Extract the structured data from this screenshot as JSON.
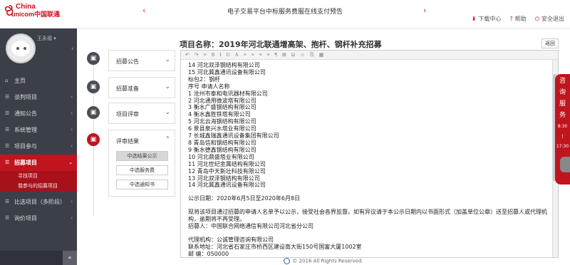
{
  "header": {
    "brand_top": "China",
    "brand_bottom": "unicom中国联通",
    "marquee_prev": "‹",
    "marquee_next": "›",
    "marquee_text": "电子交易平台中标服务费服在线支付预告",
    "links": [
      {
        "icon": "download-icon",
        "glyph": "⬇",
        "label": "下载中心"
      },
      {
        "icon": "help-icon",
        "glyph": "?",
        "label": "帮助"
      },
      {
        "icon": "logout-icon",
        "glyph": "⏻",
        "label": "安全退出"
      }
    ]
  },
  "sidebar": {
    "user_name": "王永福 ▾",
    "collapse": "‹",
    "items": [
      {
        "glyph": "⌂",
        "label": "主页",
        "arrow": "",
        "active": false
      },
      {
        "glyph": "☰",
        "label": "谈判项目",
        "arrow": "›",
        "active": false
      },
      {
        "glyph": "☰",
        "label": "通知公告",
        "arrow": "›",
        "active": false
      },
      {
        "glyph": "☰",
        "label": "系统管理",
        "arrow": "›",
        "active": false
      },
      {
        "glyph": "☰",
        "label": "项目参与",
        "arrow": "›",
        "active": false
      },
      {
        "glyph": "☰",
        "label": "招募项目",
        "arrow": "⌄",
        "active": true
      }
    ],
    "sub_items": [
      "寻找项目",
      "我参与的招募项目"
    ],
    "items_after": [
      {
        "glyph": "☰",
        "label": "比选项目（多阶段）",
        "arrow": "›"
      },
      {
        "glyph": "☰",
        "label": "询价项目",
        "arrow": "›"
      }
    ],
    "bottom_toggle": "«"
  },
  "steps": [
    {
      "label": "招募公告",
      "chevron": "⌄"
    },
    {
      "label": "招募准备",
      "chevron": "⌄"
    },
    {
      "label": "项目评审",
      "chevron": "⌄"
    },
    {
      "label": "评审结果",
      "chevron": "⌃",
      "buttons": [
        "中选结果公示",
        "中选服务费",
        "中选通知书"
      ]
    }
  ],
  "main": {
    "title": "项目名称：2019年河北联通增高架、抱杆、钢杆补充招募",
    "back": "返回",
    "toolbar": [
      "↶",
      "↷",
      "≡",
      "B",
      "I",
      "U",
      "A",
      "≡",
      "≡",
      "≡",
      "≡",
      "¶",
      "⊞",
      "Ω",
      "☺",
      "⎘",
      "▦"
    ],
    "lines_top": [
      "14 河北双泽钢结构有限公司",
      "15 河北冀鑫通讯设备有限公司",
      "标包2：钢杆",
      "序号  申请人名称",
      "1 沧州市泰和电讯器材有限公司",
      "2 河北通用微波塔有限公司",
      "3 衡水广盛钢结构有限公司",
      "4 衡水鑫胜铁塔有限公司",
      "5 河北云海钢结构有限公司",
      "6 景县泉兴水塔业有限公司",
      "7 长城鑫瑞鑫通讯设备集团有限公司",
      "8 青岛信和钢结构有限公司",
      "9 衡水德鑫钢结构有限公司",
      "10 河北鼎盛塔业有限公司",
      "11 河北世纪金属结构有限公司",
      "12 青岛中天斯壮科技有限公司",
      "13 河北双泽钢结构有限公司",
      "14 河北冀鑫通讯设备有限公司"
    ],
    "period": "公示日期：2020年6月5日至2020年6月8日",
    "notice": "现将该项目通过招募的申请人名单予以公示，接受社会各界监督。如有异议请于本公示日期内以书面形式（加盖单位公章）送至招募人或代理机构，逾期将不再受理。",
    "recruiter": "招募人：中国联合网络通信有限公司河北省分公司",
    "agency": "代理机构：公诚管理咨询有限公司",
    "address": "联系地址：河北省石家庄市桥西区建设南大街150号国富大厦1002室",
    "postcode": "邮    编：050000"
  },
  "consult": {
    "label": [
      "咨",
      "询",
      "服",
      "务"
    ],
    "time_start": "8:30",
    "time_sep": "|",
    "time_end": "17:30"
  },
  "footer": {
    "copyright": "© 2016 All Rights Reserved."
  },
  "colors": {
    "accent": "#c0141e",
    "sidebar": "#3b3f47"
  }
}
